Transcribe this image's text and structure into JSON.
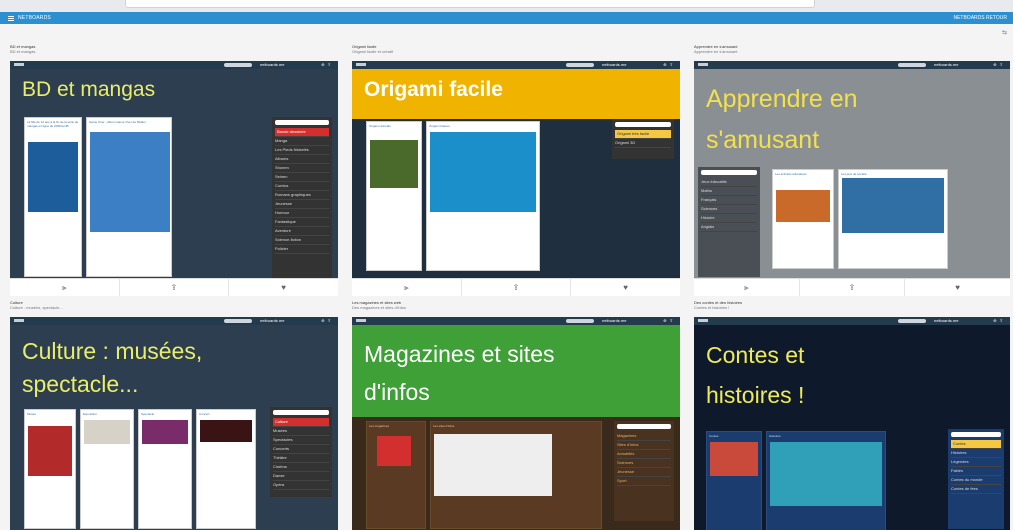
{
  "app": {
    "title": "NETBOARDS",
    "right_label": "NETBOARDS RETOUR"
  },
  "cards": [
    {
      "title": "BD et mangas",
      "subtitle": "BD et mangas",
      "banner": "BD et mangas",
      "brand": "netboards.me",
      "colors": {
        "bg": "#2d3e50",
        "banner_bg": "#2d3e50",
        "banner_text": "#e9ed6a",
        "sidebar_bg": "#333333"
      },
      "posts": [
        "La fille de 12 ans à la fin de la série de mangas en ligne de ZORGLUB",
        "Game Over - Album Game Over de Midam"
      ],
      "sidebar": [
        "Bande dessinée",
        "Manga",
        "Les Pieds Nickelés",
        "Albums",
        "Shonen",
        "Seinen",
        "Comics",
        "Romans graphiques",
        "Jeunesse",
        "Humour",
        "Fantastique",
        "Aventure",
        "Science-fiction",
        "Policier"
      ]
    },
    {
      "title": "Origami facile",
      "subtitle": "Origami facile et créatif",
      "banner": "Origami facile",
      "brand": "netboards.me",
      "colors": {
        "bg": "#1f2f40",
        "banner_bg": "#f0b400",
        "banner_text": "#ffffff"
      },
      "posts": [
        "Origami animals",
        "Origami bateau"
      ],
      "sidebar": [
        "Origami très facile",
        "Origami 3D"
      ]
    },
    {
      "title": "Apprendre en s'amusant",
      "subtitle": "Apprendre en s'amusant",
      "banner_lines": [
        "Apprendre en",
        "s'amusant"
      ],
      "brand": "netboards.me",
      "colors": {
        "bg": "#8a8f93",
        "banner_bg": "#8f9598",
        "banner_text": "#f2e04d"
      },
      "posts": [
        "Les activités éducatives",
        "Les jeux de société"
      ],
      "sidebar": [
        "Jeux éducatifs",
        "Maths",
        "Français",
        "Sciences",
        "Histoire",
        "Anglais"
      ]
    },
    {
      "title": "Culture",
      "subtitle": "Culture : musées, spectacle...",
      "banner_lines": [
        "Culture : musées,",
        "spectacle..."
      ],
      "brand": "netboards.me",
      "colors": {
        "bg": "#2d3e50",
        "banner_bg": "#2d3e50",
        "banner_text": "#e9ed6a"
      },
      "posts": [
        "Musée",
        "Exposition",
        "Spectacle",
        "Concert"
      ],
      "sidebar": [
        "Culture",
        "Musées",
        "Spectacles",
        "Concerts",
        "Théâtre",
        "Cinéma",
        "Danse",
        "Opéra"
      ]
    },
    {
      "title": "Les magazines et sites web",
      "subtitle": "Des magazines et sites d'infos",
      "banner_lines": [
        "Magazines et sites",
        "d'infos"
      ],
      "brand": "netboards.me",
      "colors": {
        "bg": "#3a2a1c",
        "banner_bg": "#3ea036",
        "banner_text": "#ffffff"
      },
      "posts": [
        "Les magazines",
        "Les sites d'infos"
      ],
      "sidebar": [
        "Magazines",
        "Sites d'infos",
        "Actualités",
        "Sciences",
        "Jeunesse",
        "Sport"
      ]
    },
    {
      "title": "Des contes et des histoires",
      "subtitle": "Contes et histoires !",
      "banner_lines": [
        "Contes et",
        "histoires !"
      ],
      "brand": "netboards.me",
      "colors": {
        "bg": "#0e1a2b",
        "banner_bg": "#0e1a2b",
        "banner_text": "#f0ea5a"
      },
      "posts": [
        "Contes",
        "Histoires"
      ],
      "sidebar": [
        "Contes",
        "Histoires",
        "Légendes",
        "Fables",
        "Contes du monde",
        "Contes de fées"
      ]
    }
  ],
  "toolbar_icons": [
    "tool-icon",
    "share-icon",
    "like-icon"
  ]
}
